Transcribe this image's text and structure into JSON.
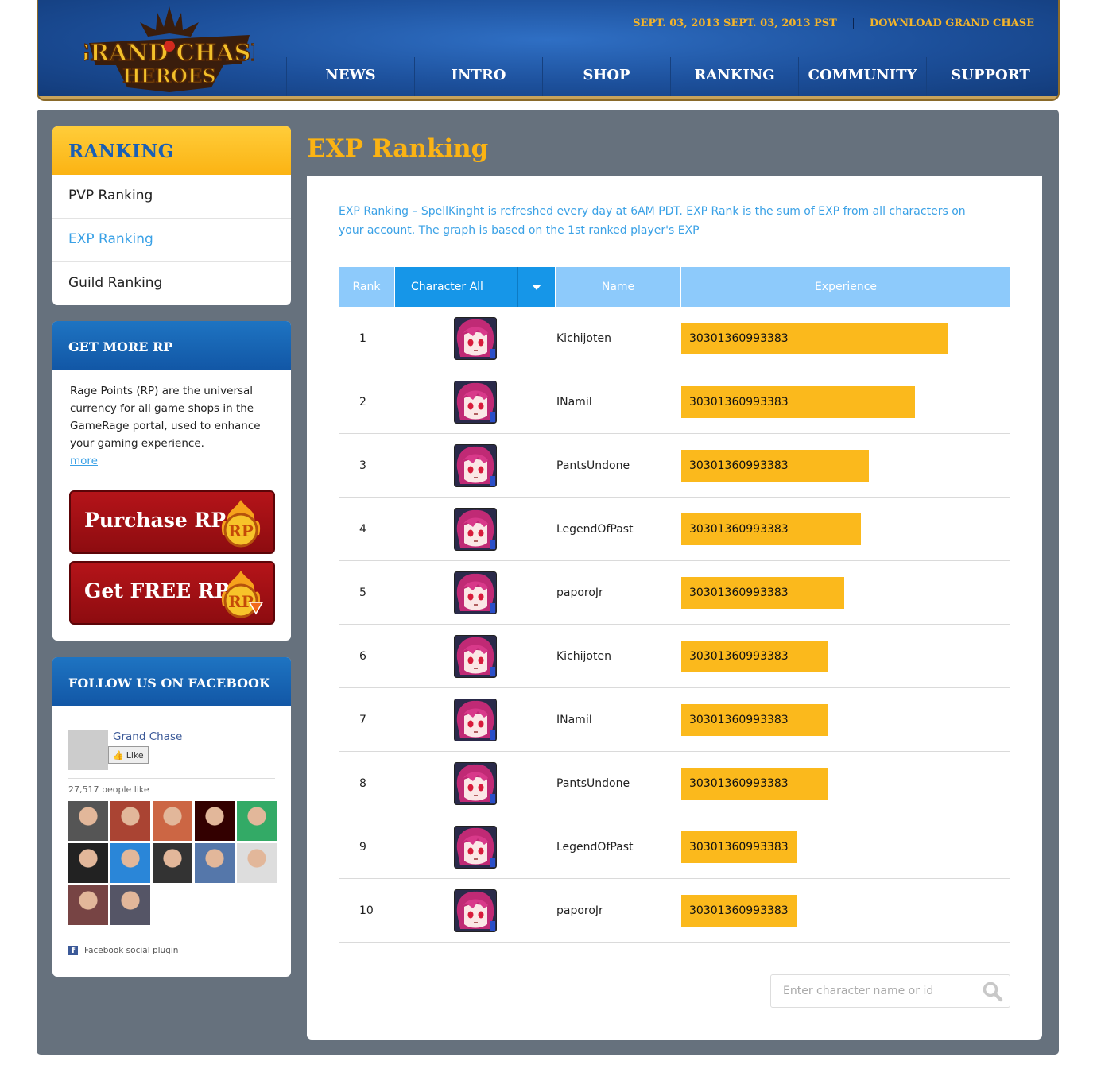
{
  "header": {
    "logo_line1": "GRAND CHASE",
    "logo_line2": "HEROES",
    "date_label": "SEPT. 03, 2013 SEPT. 03, 2013  PST",
    "download_label": "DOWNLOAD GRAND CHASE",
    "nav": [
      {
        "label": "NEWS"
      },
      {
        "label": "INTRO"
      },
      {
        "label": "SHOP"
      },
      {
        "label": "RANKING"
      },
      {
        "label": "COMMUNITY"
      },
      {
        "label": "SUPPORT"
      }
    ]
  },
  "sidebar": {
    "ranking_title": "RANKING",
    "ranking_links": [
      {
        "label": "PVP Ranking",
        "active": false
      },
      {
        "label": "EXP Ranking",
        "active": true
      },
      {
        "label": "Guild Ranking",
        "active": false
      }
    ],
    "rp": {
      "title": "GET MORE RP",
      "text": "Rage Points (RP) are the universal currency for all game shops in the GameRage portal, used to enhance your gaming experience.",
      "more": "more",
      "purchase": "Purchase RP",
      "free": "Get FREE RP",
      "badge": "RP"
    },
    "facebook": {
      "title": "FOLLOW US ON FACEBOOK",
      "page_name": "Grand Chase",
      "like": "Like",
      "count": "27,517 people like",
      "plugin": "Facebook social plugin",
      "face_colors": [
        "#555",
        "#a43",
        "#c64",
        "#300",
        "#3a6",
        "#222",
        "#2a86d8",
        "#333",
        "#57a",
        "#ddd",
        "#744",
        "#556"
      ]
    }
  },
  "main": {
    "title": "EXP Ranking",
    "description": "EXP Ranking – SpellKinght is refreshed every day at 6AM PDT. EXP Rank is the sum of EXP from all characters on your account. The graph is based on the 1st ranked player's EXP",
    "columns": {
      "rank": "Rank",
      "character": "Character All",
      "name": "Name",
      "experience": "Experience"
    },
    "rows": [
      {
        "rank": "1",
        "name": "Kichijoten",
        "exp": "30301360993383",
        "fraction": 0.81
      },
      {
        "rank": "2",
        "name": "INamiI",
        "exp": "30301360993383",
        "fraction": 0.71
      },
      {
        "rank": "3",
        "name": "PantsUndone",
        "exp": "30301360993383",
        "fraction": 0.57
      },
      {
        "rank": "4",
        "name": "LegendOfPast",
        "exp": "30301360993383",
        "fraction": 0.545
      },
      {
        "rank": "5",
        "name": "paporoJr",
        "exp": "30301360993383",
        "fraction": 0.495
      },
      {
        "rank": "6",
        "name": "Kichijoten",
        "exp": "30301360993383",
        "fraction": 0.447
      },
      {
        "rank": "7",
        "name": "INamiI",
        "exp": "30301360993383",
        "fraction": 0.447
      },
      {
        "rank": "8",
        "name": "PantsUndone",
        "exp": "30301360993383",
        "fraction": 0.447
      },
      {
        "rank": "9",
        "name": "LegendOfPast",
        "exp": "30301360993383",
        "fraction": 0.35
      },
      {
        "rank": "10",
        "name": "paporoJr",
        "exp": "30301360993383",
        "fraction": 0.35
      }
    ],
    "search_placeholder": "Enter character name or id",
    "colors": {
      "accent": "#fbb313",
      "link": "#3aa1e6",
      "bar": "#fbb91c",
      "header": "#8dcafb"
    }
  }
}
